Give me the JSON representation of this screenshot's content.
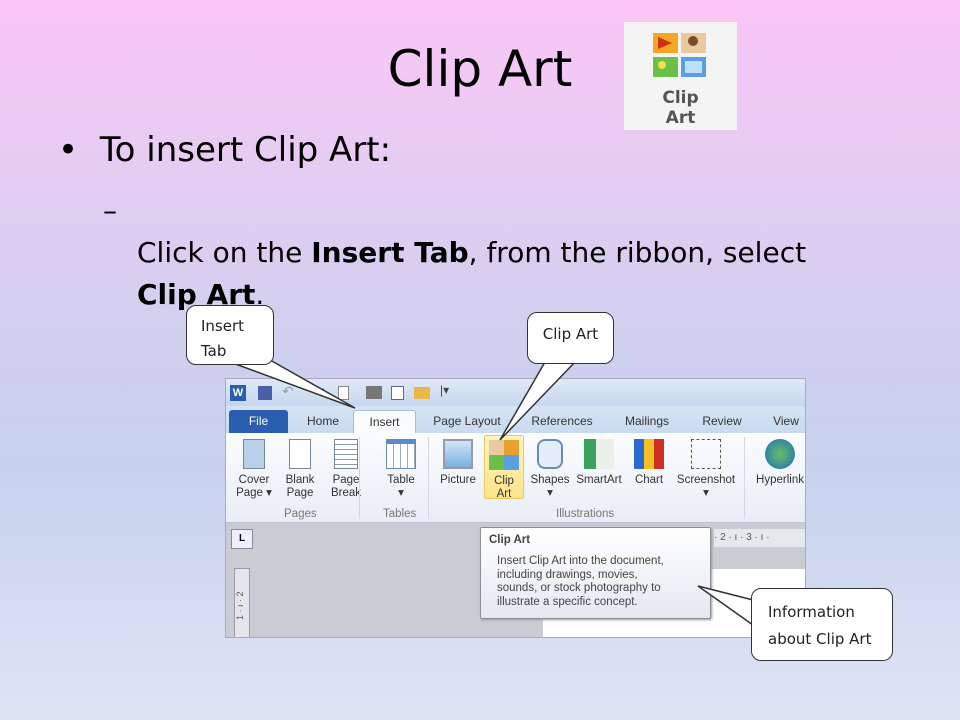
{
  "slide": {
    "title": "Clip Art",
    "bullet": "To insert Clip Art:",
    "sub": {
      "pre": "Click on the ",
      "b1": "Insert Tab",
      "mid": ", from the ribbon, select ",
      "b2": "Clip Art",
      "post": "."
    },
    "icon_label": [
      "Clip",
      "Art"
    ]
  },
  "word": {
    "tabs": [
      "File",
      "Home",
      "Insert",
      "Page Layout",
      "References",
      "Mailings",
      "Review",
      "View"
    ],
    "active_tab": "Insert",
    "buttons": [
      [
        "Cover",
        "Page ▾"
      ],
      [
        "Blank",
        "Page"
      ],
      [
        "Page",
        "Break"
      ],
      [
        "Table",
        "▾"
      ],
      [
        "Picture",
        ""
      ],
      [
        "Clip",
        "Art"
      ],
      [
        "Shapes",
        "▾"
      ],
      [
        "SmartArt",
        ""
      ],
      [
        "Chart",
        ""
      ],
      [
        "Screenshot",
        "▾"
      ],
      [
        "Hyperlink",
        ""
      ]
    ],
    "groups": [
      "Pages",
      "Tables",
      "Illustrations"
    ],
    "ruler": "· 2 · ı · 3 · ı ·",
    "vruler": "1 · ı · 2",
    "tooltip": {
      "title": "Clip Art",
      "lines": [
        "Insert Clip Art into the document,",
        "including drawings, movies,",
        "sounds, or stock photography to",
        "illustrate a specific concept."
      ]
    }
  },
  "callouts": {
    "insert": [
      "Insert",
      "Tab"
    ],
    "clipart": "Clip Art",
    "info": [
      "Information",
      "about Clip Art"
    ]
  }
}
